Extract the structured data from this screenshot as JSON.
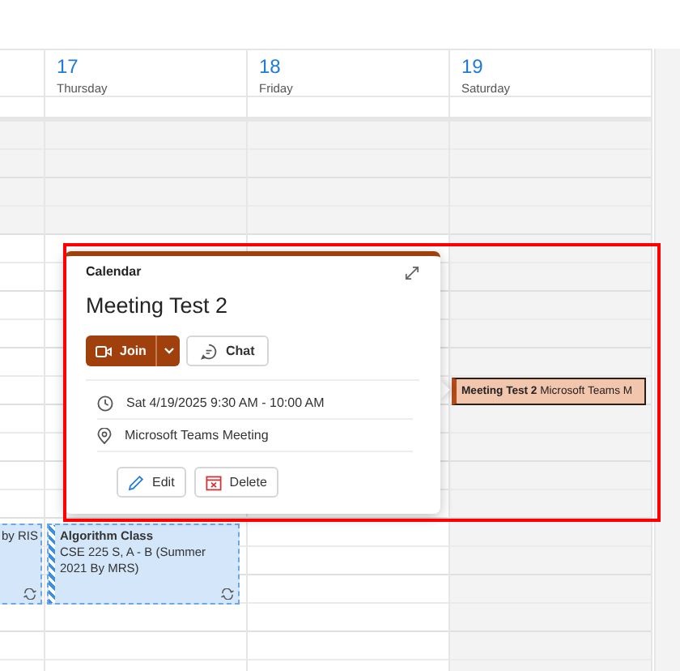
{
  "days": [
    {
      "number": "17",
      "name": "Thursday",
      "weekend": false
    },
    {
      "number": "18",
      "name": "Friday",
      "weekend": false
    },
    {
      "number": "19",
      "name": "Saturday",
      "weekend": true
    }
  ],
  "events": [
    {
      "kind": "class",
      "detail": "by RIS",
      "recurring": true,
      "selected": false
    },
    {
      "kind": "class",
      "title": "Algorithm Class",
      "detail": "CSE 225 S, A - B (Summer 2021 By MRS)",
      "recurring": true,
      "selected": false
    },
    {
      "kind": "meeting",
      "title": "Meeting Test 2",
      "detail": "Microsoft Teams M",
      "recurring": false,
      "selected": true
    }
  ],
  "popup": {
    "header": "Calendar",
    "title": "Meeting Test 2",
    "join": "Join",
    "chat": "Chat",
    "time": "Sat 4/19/2025 9:30 AM - 10:00 AM",
    "location": "Microsoft Teams Meeting",
    "edit": "Edit",
    "delete": "Delete"
  },
  "annotation": {
    "kind": "rectangle",
    "color": "#ff0000"
  }
}
